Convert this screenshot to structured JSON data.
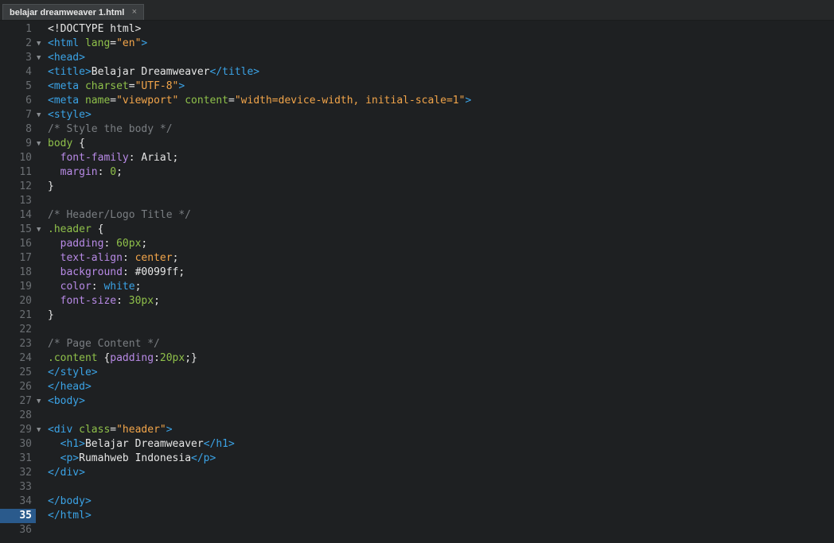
{
  "tab": {
    "title": "belajar dreamweaver 1.html",
    "close_glyph": "×"
  },
  "active_line": 35,
  "colors": {
    "tag": "#3ba3e6",
    "attr": "#8fc04a",
    "string": "#f2a54a",
    "comment": "#7a7e82",
    "property": "#b88ae6",
    "plain": "#e6e6e6",
    "active_line_bg": "#2a5a8c"
  },
  "lines": [
    {
      "n": "1",
      "fold": "",
      "tokens": [
        [
          "pl",
          "<!DOCTYPE html>"
        ]
      ]
    },
    {
      "n": "2",
      "fold": "▼",
      "tokens": [
        [
          "tag",
          "<html"
        ],
        [
          "pl",
          " "
        ],
        [
          "attr",
          "lang"
        ],
        [
          "pl",
          "="
        ],
        [
          "str",
          "\"en\""
        ],
        [
          "tag",
          ">"
        ]
      ]
    },
    {
      "n": "3",
      "fold": "▼",
      "tokens": [
        [
          "tag",
          "<head>"
        ]
      ]
    },
    {
      "n": "4",
      "fold": "",
      "tokens": [
        [
          "tag",
          "<title>"
        ],
        [
          "pl",
          "Belajar Dreamweaver"
        ],
        [
          "tag",
          "</title>"
        ]
      ]
    },
    {
      "n": "5",
      "fold": "",
      "tokens": [
        [
          "tag",
          "<meta"
        ],
        [
          "pl",
          " "
        ],
        [
          "attr",
          "charset"
        ],
        [
          "pl",
          "="
        ],
        [
          "str",
          "\"UTF-8\""
        ],
        [
          "tag",
          ">"
        ]
      ]
    },
    {
      "n": "6",
      "fold": "",
      "tokens": [
        [
          "tag",
          "<meta"
        ],
        [
          "pl",
          " "
        ],
        [
          "attr",
          "name"
        ],
        [
          "pl",
          "="
        ],
        [
          "str",
          "\"viewport\""
        ],
        [
          "pl",
          " "
        ],
        [
          "attr",
          "content"
        ],
        [
          "pl",
          "="
        ],
        [
          "str",
          "\"width=device-width, initial-scale=1\""
        ],
        [
          "tag",
          ">"
        ]
      ]
    },
    {
      "n": "7",
      "fold": "▼",
      "tokens": [
        [
          "tag",
          "<style>"
        ]
      ]
    },
    {
      "n": "8",
      "fold": "",
      "tokens": [
        [
          "cmt",
          "/* Style the body */"
        ]
      ]
    },
    {
      "n": "9",
      "fold": "▼",
      "tokens": [
        [
          "sel",
          "body"
        ],
        [
          "pl",
          " {"
        ]
      ]
    },
    {
      "n": "10",
      "fold": "",
      "tokens": [
        [
          "pl",
          "  "
        ],
        [
          "prop",
          "font-family"
        ],
        [
          "pl",
          ": Arial;"
        ]
      ]
    },
    {
      "n": "11",
      "fold": "",
      "tokens": [
        [
          "pl",
          "  "
        ],
        [
          "prop",
          "margin"
        ],
        [
          "pl",
          ": "
        ],
        [
          "num",
          "0"
        ],
        [
          "pl",
          ";"
        ]
      ]
    },
    {
      "n": "12",
      "fold": "",
      "tokens": [
        [
          "pl",
          "}"
        ]
      ]
    },
    {
      "n": "13",
      "fold": "",
      "tokens": []
    },
    {
      "n": "14",
      "fold": "",
      "tokens": [
        [
          "cmt",
          "/* Header/Logo Title */"
        ]
      ]
    },
    {
      "n": "15",
      "fold": "▼",
      "tokens": [
        [
          "sel",
          ".header"
        ],
        [
          "pl",
          " {"
        ]
      ]
    },
    {
      "n": "16",
      "fold": "",
      "tokens": [
        [
          "pl",
          "  "
        ],
        [
          "prop",
          "padding"
        ],
        [
          "pl",
          ": "
        ],
        [
          "num",
          "60px"
        ],
        [
          "pl",
          ";"
        ]
      ]
    },
    {
      "n": "17",
      "fold": "",
      "tokens": [
        [
          "pl",
          "  "
        ],
        [
          "prop",
          "text-align"
        ],
        [
          "pl",
          ": "
        ],
        [
          "str",
          "center"
        ],
        [
          "pl",
          ";"
        ]
      ]
    },
    {
      "n": "18",
      "fold": "",
      "tokens": [
        [
          "pl",
          "  "
        ],
        [
          "prop",
          "background"
        ],
        [
          "pl",
          ": "
        ],
        [
          "pl",
          "#0099ff"
        ],
        [
          "pl",
          ";"
        ]
      ]
    },
    {
      "n": "19",
      "fold": "",
      "tokens": [
        [
          "pl",
          "  "
        ],
        [
          "prop",
          "color"
        ],
        [
          "pl",
          ": "
        ],
        [
          "kw",
          "white"
        ],
        [
          "pl",
          ";"
        ]
      ]
    },
    {
      "n": "20",
      "fold": "",
      "tokens": [
        [
          "pl",
          "  "
        ],
        [
          "prop",
          "font-size"
        ],
        [
          "pl",
          ": "
        ],
        [
          "num",
          "30px"
        ],
        [
          "pl",
          ";"
        ]
      ]
    },
    {
      "n": "21",
      "fold": "",
      "tokens": [
        [
          "pl",
          "}"
        ]
      ]
    },
    {
      "n": "22",
      "fold": "",
      "tokens": []
    },
    {
      "n": "23",
      "fold": "",
      "tokens": [
        [
          "cmt",
          "/* Page Content */"
        ]
      ]
    },
    {
      "n": "24",
      "fold": "",
      "tokens": [
        [
          "sel",
          ".content"
        ],
        [
          "pl",
          " {"
        ],
        [
          "prop",
          "padding"
        ],
        [
          "pl",
          ":"
        ],
        [
          "num",
          "20px"
        ],
        [
          "pl",
          ";}"
        ]
      ]
    },
    {
      "n": "25",
      "fold": "",
      "tokens": [
        [
          "tag",
          "</style>"
        ]
      ]
    },
    {
      "n": "26",
      "fold": "",
      "tokens": [
        [
          "tag",
          "</head>"
        ]
      ]
    },
    {
      "n": "27",
      "fold": "▼",
      "tokens": [
        [
          "tag",
          "<body>"
        ]
      ]
    },
    {
      "n": "28",
      "fold": "",
      "tokens": []
    },
    {
      "n": "29",
      "fold": "▼",
      "tokens": [
        [
          "tag",
          "<div"
        ],
        [
          "pl",
          " "
        ],
        [
          "attr",
          "class"
        ],
        [
          "pl",
          "="
        ],
        [
          "str",
          "\"header\""
        ],
        [
          "tag",
          ">"
        ]
      ]
    },
    {
      "n": "30",
      "fold": "",
      "tokens": [
        [
          "pl",
          "  "
        ],
        [
          "tag",
          "<h1>"
        ],
        [
          "pl",
          "Belajar Dreamweaver"
        ],
        [
          "tag",
          "</h1>"
        ]
      ]
    },
    {
      "n": "31",
      "fold": "",
      "tokens": [
        [
          "pl",
          "  "
        ],
        [
          "tag",
          "<p>"
        ],
        [
          "pl",
          "Rumahweb Indonesia"
        ],
        [
          "tag",
          "</p>"
        ]
      ]
    },
    {
      "n": "32",
      "fold": "",
      "tokens": [
        [
          "tag",
          "</div>"
        ]
      ]
    },
    {
      "n": "33",
      "fold": "",
      "tokens": []
    },
    {
      "n": "34",
      "fold": "",
      "tokens": [
        [
          "tag",
          "</body>"
        ]
      ]
    },
    {
      "n": "35",
      "fold": "",
      "tokens": [
        [
          "tag",
          "</html>"
        ]
      ]
    },
    {
      "n": "36",
      "fold": "",
      "tokens": []
    }
  ]
}
